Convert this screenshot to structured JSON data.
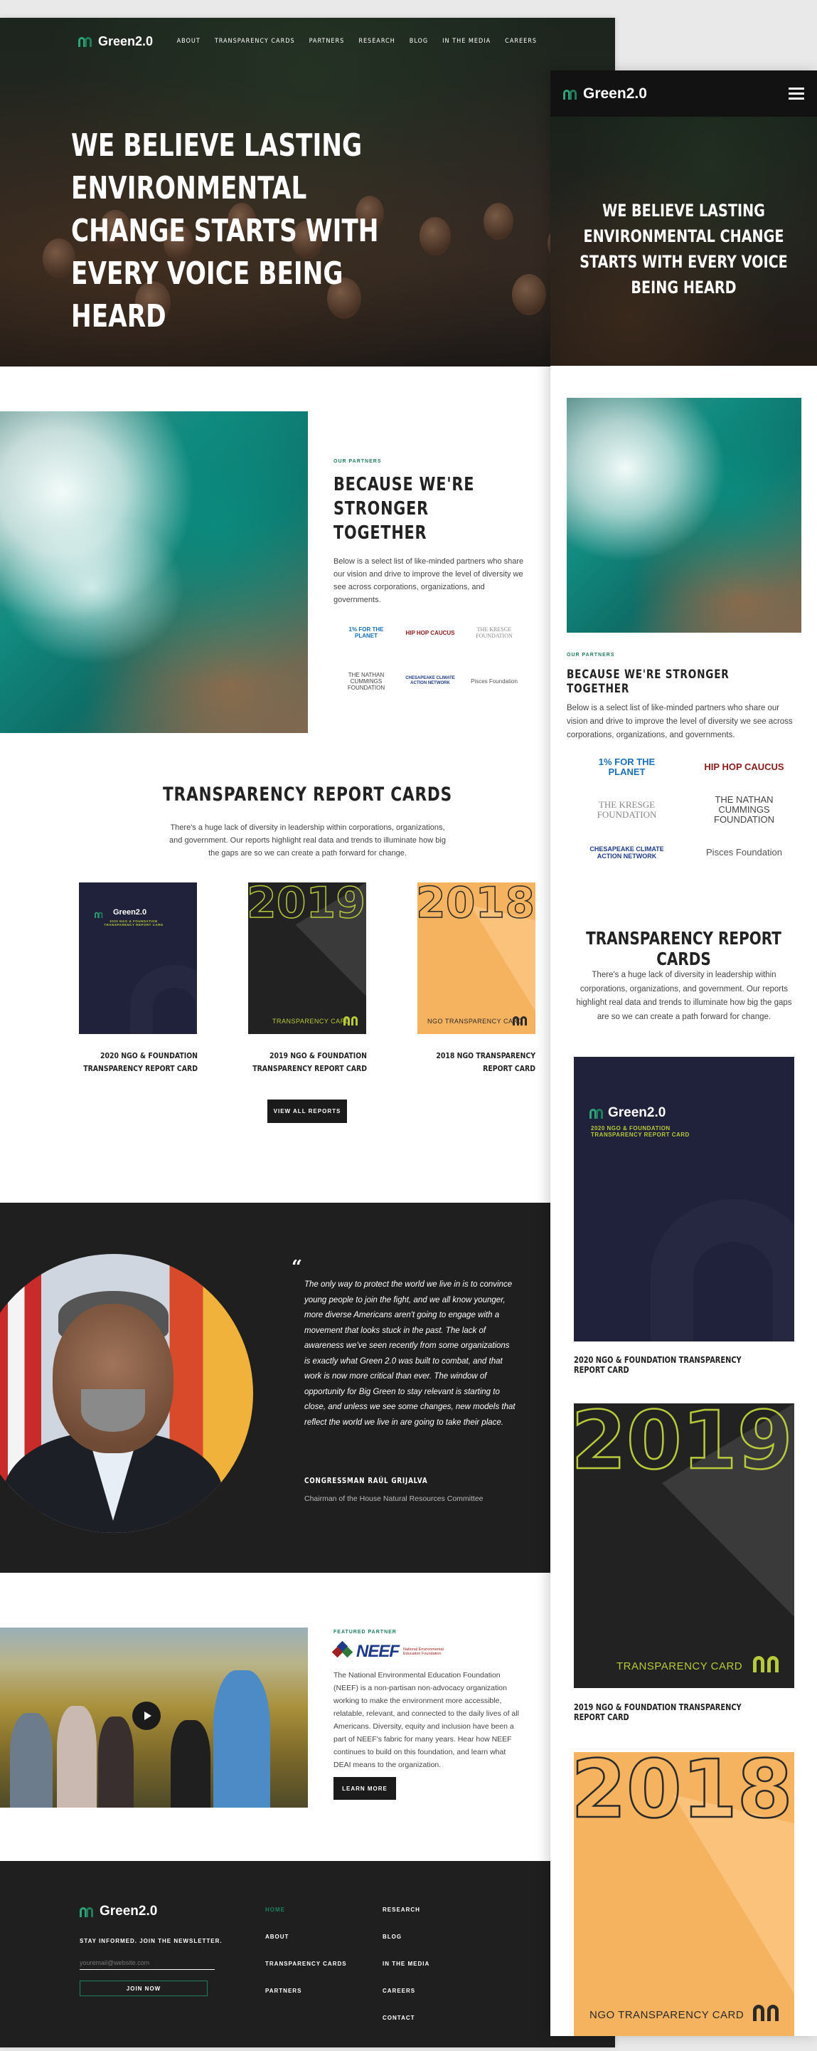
{
  "brand": {
    "name": "Green2.0",
    "accent": "#1f7f5d",
    "dark": "#1f1f1f"
  },
  "nav": {
    "items": [
      "ABOUT",
      "TRANSPARENCY CARDS",
      "PARTNERS",
      "RESEARCH",
      "BLOG",
      "IN THE MEDIA",
      "CAREERS"
    ]
  },
  "hero": {
    "headline": "WE BELIEVE LASTING ENVIRONMENTAL CHANGE STARTS WITH EVERY VOICE BEING HEARD"
  },
  "partners": {
    "eyebrow": "OUR PARTNERS",
    "title": "BECAUSE WE'RE STRONGER TOGETHER",
    "body": "Below is a select list of like-minded partners who share our vision and drive to improve the level of diversity we see across corporations, organizations, and governments.",
    "logos": [
      "1% FOR THE PLANET",
      "HIP HOP CAUCUS",
      "THE KRESGE FOUNDATION",
      "THE NATHAN CUMMINGS FOUNDATION",
      "CHESAPEAKE CLIMATE ACTION NETWORK",
      "Pisces Foundation"
    ]
  },
  "report_cards": {
    "title": "TRANSPARENCY REPORT CARDS",
    "intro": "There's a huge lack of diversity in leadership within corporations, organizations, and government. Our reports highlight real data and trends to illuminate how big the gaps are so we can create a path forward for change.",
    "cards": [
      {
        "title": "2020 NGO & FOUNDATION TRANSPARENCY REPORT CARD",
        "logo": "Green2.0",
        "subtitle": "2020 NGO & FOUNDATION TRANSPARENCY REPORT CARD"
      },
      {
        "title": "2019 NGO & FOUNDATION TRANSPARENCY REPORT CARD",
        "year": "2019",
        "footer": "TRANSPARENCY CARD"
      },
      {
        "title": "2018 NGO TRANSPARENCY REPORT CARD",
        "year": "2018",
        "footer": "NGO TRANSPARENCY CARD"
      }
    ],
    "button": "VIEW ALL REPORTS"
  },
  "quote": {
    "mark": "“",
    "text": "The only way to protect the world we live in is to convince young people to join the fight, and we all know younger, more diverse Americans aren't going to engage with a movement that looks stuck in the past. The lack of awareness we've seen recently from some organizations is exactly what Green 2.0 was built to combat, and that work is now more critical than ever. The window of opportunity for Big Green to stay relevant is starting to close, and unless we see some changes, new models that reflect the world we live in are going to take their place.",
    "name": "CONGRESSMAN RAÚL GRIJALVA",
    "role": "Chairman of the House Natural Resources Committee"
  },
  "featured": {
    "eyebrow": "FEATURED PARTNER",
    "logo_word": "NEEF",
    "logo_sub": "National Environmental Education Foundation",
    "body": "The National Environmental Education Foundation (NEEF) is a non-partisan non-advocacy organization working to make the environment more accessible, relatable, relevant, and connected to the daily lives of all Americans. Diversity, equity and inclusion have been a part of NEEF's fabric for many years. Hear how NEEF continues to build on this foundation, and learn what DEAI means to the organization.",
    "button": "LEARN MORE"
  },
  "footer": {
    "newsletter": "STAY INFORMED. JOIN THE NEWSLETTER.",
    "email_placeholder": "youremail@website.com",
    "join": "JOIN NOW",
    "col1": [
      "HOME",
      "ABOUT",
      "TRANSPARENCY CARDS",
      "PARTNERS"
    ],
    "col2": [
      "RESEARCH",
      "BLOG",
      "IN THE MEDIA",
      "CAREERS",
      "CONTACT"
    ]
  },
  "mobile": {
    "headline": "WE BELIEVE LASTING ENVIRONMENTAL CHANGE STARTS WITH EVERY VOICE BEING HEARD"
  }
}
